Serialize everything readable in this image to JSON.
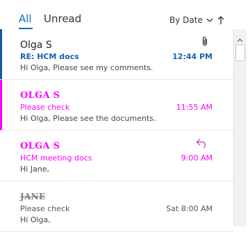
{
  "header": {
    "tabs": [
      "All",
      "Unread"
    ],
    "sort_label": "By Date"
  },
  "icons": {
    "sort_dropdown": "chevron-down-icon",
    "sort_direction": "arrow-up-icon",
    "attachment": "paperclip-icon",
    "reply": "reply-arrow-icon"
  },
  "colors": {
    "accent_blue": "#106ebe",
    "selected_bar": "#0f5aa8",
    "magenta": "#ff00ff"
  },
  "messages": [
    {
      "sender": "Olga S",
      "subject": "RE: HCM docs",
      "time": "12:44 PM",
      "preview": "Hi Olga,  Please see my comments."
    },
    {
      "sender": "OLGA S",
      "subject": "Please check",
      "time": "11:55 AM",
      "preview": "Hi Olga,  Please see the documents."
    },
    {
      "sender": "OLGA S",
      "subject": "HCM meeting docs",
      "time": "9:00 AM",
      "preview": "Hi Jane,"
    },
    {
      "sender": "JANE",
      "subject": "Please check",
      "time": "Sat 8:00 AM",
      "preview": "Hi Olga,"
    }
  ]
}
